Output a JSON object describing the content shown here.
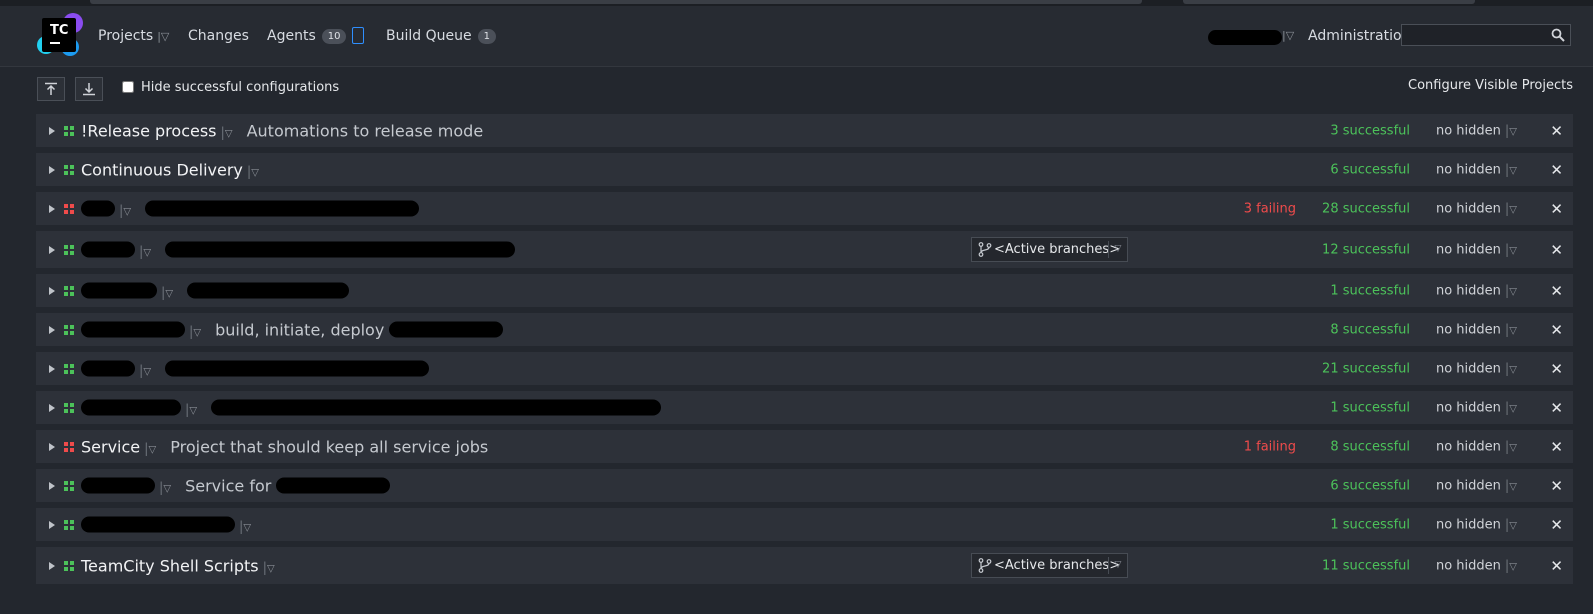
{
  "header": {
    "logo_text": "TC",
    "nav": {
      "projects": "Projects",
      "changes": "Changes",
      "agents": "Agents",
      "agents_count": "10",
      "build_queue": "Build Queue",
      "build_queue_count": "1"
    },
    "administration": "Administration",
    "search": {
      "value": "",
      "placeholder": ""
    }
  },
  "toolbar": {
    "hide_successful_label": "Hide successful configurations",
    "hide_successful_checked": false,
    "configure_visible": "Configure Visible Projects"
  },
  "branch_selector_label": "<Active branches>",
  "projects": [
    {
      "title": "!Release process",
      "description": "Automations to release mode",
      "status": "green",
      "failing": "",
      "successful": "3 successful",
      "hidden": "no hidden"
    },
    {
      "title": "Continuous Delivery",
      "description": "",
      "status": "green",
      "failing": "",
      "successful": "6 successful",
      "hidden": "no hidden"
    },
    {
      "title": "",
      "description": "",
      "status": "red",
      "failing": "3 failing",
      "successful": "28 successful",
      "hidden": "no hidden"
    },
    {
      "title": "",
      "description": "",
      "status": "green",
      "failing": "",
      "successful": "12 successful",
      "hidden": "no hidden",
      "branch": true
    },
    {
      "title": "",
      "description": "",
      "status": "green",
      "failing": "",
      "successful": "1 successful",
      "hidden": "no hidden"
    },
    {
      "title": "",
      "description": "build, initiate, deploy",
      "status": "green",
      "failing": "",
      "successful": "8 successful",
      "hidden": "no hidden"
    },
    {
      "title": "",
      "description": "",
      "status": "green",
      "failing": "",
      "successful": "21 successful",
      "hidden": "no hidden"
    },
    {
      "title": "",
      "description": "",
      "status": "green",
      "failing": "",
      "successful": "1 successful",
      "hidden": "no hidden"
    },
    {
      "title": "Service",
      "description": "Project that should keep all service jobs",
      "status": "red",
      "failing": "1 failing",
      "successful": "8 successful",
      "hidden": "no hidden"
    },
    {
      "title": "",
      "description": "Service for",
      "status": "green",
      "failing": "",
      "successful": "6 successful",
      "hidden": "no hidden"
    },
    {
      "title": "",
      "description": "",
      "status": "green",
      "failing": "",
      "successful": "1 successful",
      "hidden": "no hidden"
    },
    {
      "title": "TeamCity Shell Scripts",
      "description": "",
      "status": "green",
      "failing": "",
      "successful": "11 successful",
      "hidden": "no hidden",
      "branch": true
    }
  ],
  "colors": {
    "background": "#23272e",
    "row": "#2d3139",
    "success": "#4cc25a",
    "failing": "#ef4b4b",
    "accent": "#2f8fff"
  }
}
